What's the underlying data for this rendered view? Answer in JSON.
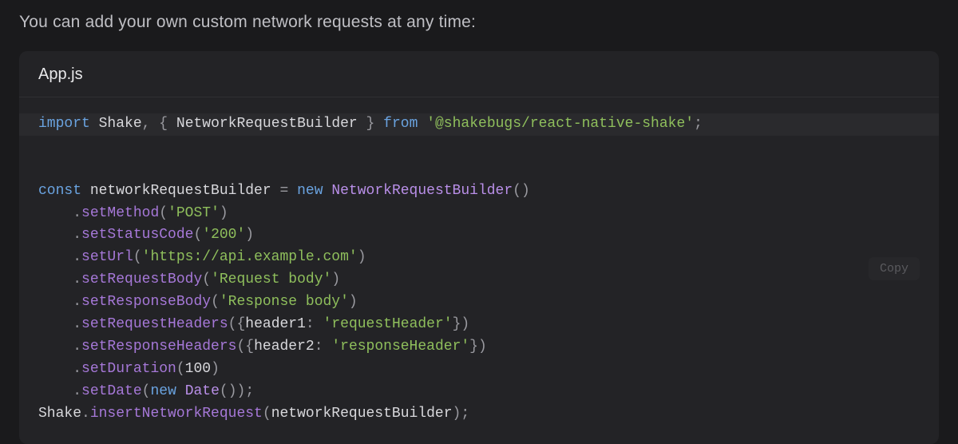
{
  "intro": "You can add your own custom network requests at any time:",
  "filename": "App.js",
  "copy_label": "Copy",
  "code": {
    "line1": {
      "import": "import",
      "shake": "Shake",
      "comma": ",",
      "lbrace": "{",
      "builder": "NetworkRequestBuilder",
      "rbrace": "}",
      "from": "from",
      "pkg": "'@shakebugs/react-native-shake'",
      "semi": ";"
    },
    "line3": {
      "const": "const",
      "varname": "networkRequestBuilder",
      "eq": "=",
      "new": "new",
      "ctor": "NetworkRequestBuilder",
      "parens": "()"
    },
    "line4": {
      "indent": "    ",
      "dot": ".",
      "fn": "setMethod",
      "lp": "(",
      "arg": "'POST'",
      "rp": ")"
    },
    "line5": {
      "indent": "    ",
      "dot": ".",
      "fn": "setStatusCode",
      "lp": "(",
      "arg": "'200'",
      "rp": ")"
    },
    "line6": {
      "indent": "    ",
      "dot": ".",
      "fn": "setUrl",
      "lp": "(",
      "arg": "'https://api.example.com'",
      "rp": ")"
    },
    "line7": {
      "indent": "    ",
      "dot": ".",
      "fn": "setRequestBody",
      "lp": "(",
      "arg": "'Request body'",
      "rp": ")"
    },
    "line8": {
      "indent": "    ",
      "dot": ".",
      "fn": "setResponseBody",
      "lp": "(",
      "arg": "'Response body'",
      "rp": ")"
    },
    "line9": {
      "indent": "    ",
      "dot": ".",
      "fn": "setRequestHeaders",
      "lp": "(",
      "lb": "{",
      "key": "header1",
      "colon": ":",
      "sp": " ",
      "val": "'requestHeader'",
      "rb": "}",
      "rp": ")"
    },
    "line10": {
      "indent": "    ",
      "dot": ".",
      "fn": "setResponseHeaders",
      "lp": "(",
      "lb": "{",
      "key": "header2",
      "colon": ":",
      "sp": " ",
      "val": "'responseHeader'",
      "rb": "}",
      "rp": ")"
    },
    "line11": {
      "indent": "    ",
      "dot": ".",
      "fn": "setDuration",
      "lp": "(",
      "arg": "100",
      "rp": ")"
    },
    "line12": {
      "indent": "    ",
      "dot": ".",
      "fn": "setDate",
      "lp": "(",
      "new": "new",
      "ctor": "Date",
      "parens": "()",
      "rp": ")",
      "semi": ";"
    },
    "line13": {
      "obj": "Shake",
      "dot": ".",
      "fn": "insertNetworkRequest",
      "lp": "(",
      "arg": "networkRequestBuilder",
      "rp": ")",
      "semi": ";"
    }
  }
}
